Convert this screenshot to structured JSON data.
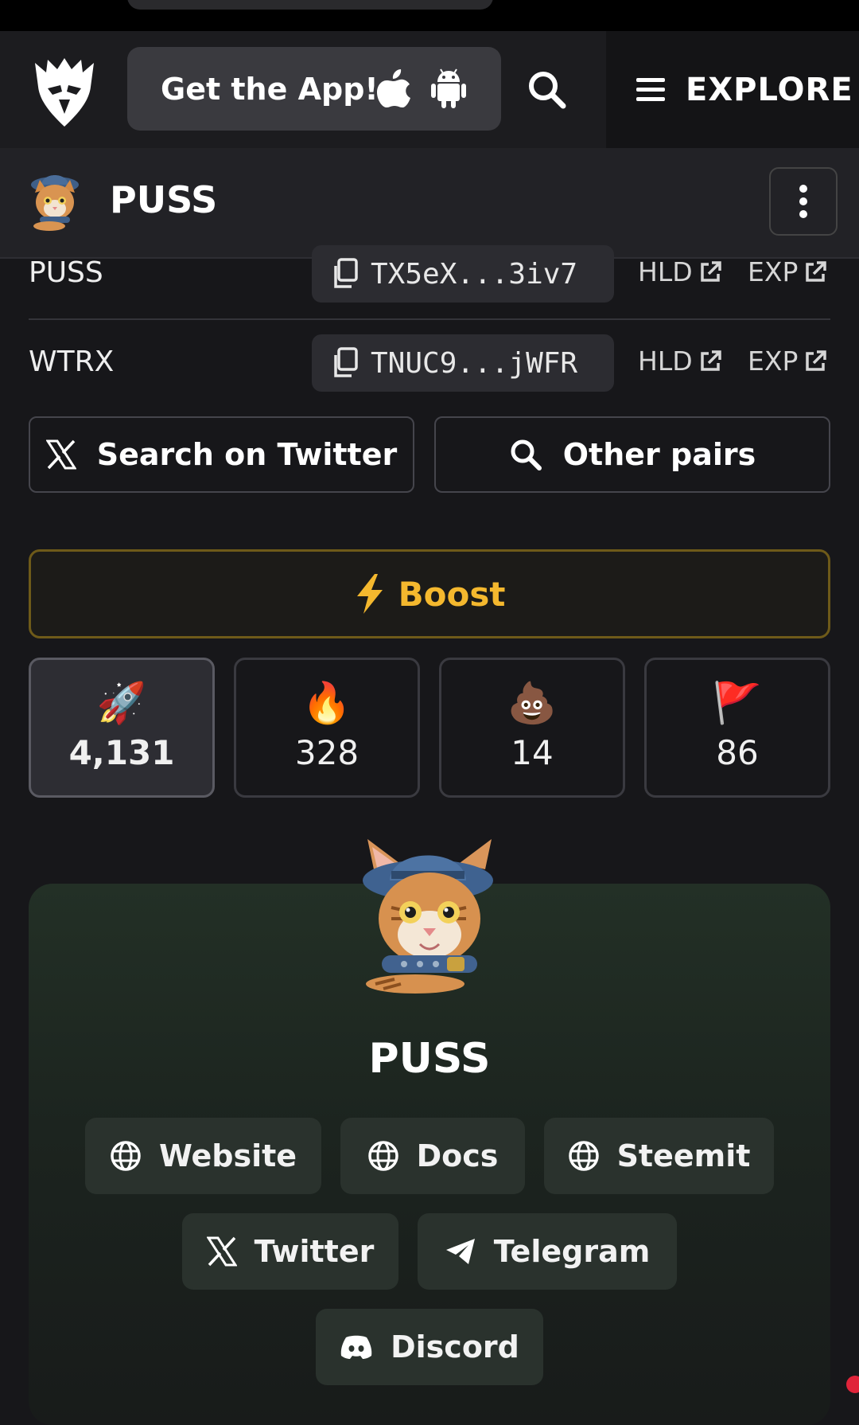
{
  "nav": {
    "get_app_label": "Get the App!",
    "explore_label": "EXPLORE"
  },
  "token_header": {
    "name": "PUSS"
  },
  "addresses": [
    {
      "symbol": "PUSS",
      "address": "TX5eX...3iv7",
      "holders_label": "HLD",
      "explorer_label": "EXP"
    },
    {
      "symbol": "WTRX",
      "address": "TNUC9...jWFR",
      "holders_label": "HLD",
      "explorer_label": "EXP"
    }
  ],
  "actions": {
    "twitter_search_label": "Search on Twitter",
    "other_pairs_label": "Other pairs",
    "boost_label": "Boost"
  },
  "reactions": [
    {
      "emoji": "🚀",
      "count": "4,131",
      "active": true
    },
    {
      "emoji": "🔥",
      "count": "328"
    },
    {
      "emoji": "💩",
      "count": "14"
    },
    {
      "emoji": "🚩",
      "count": "86"
    }
  ],
  "profile": {
    "name": "PUSS",
    "links": [
      "Website",
      "Docs",
      "Steemit",
      "Twitter",
      "Telegram",
      "Discord"
    ]
  },
  "colors": {
    "boost": "#f4b82e",
    "page_bg": "#17171a"
  },
  "icons": [
    "eagle-logo-icon",
    "apple-icon",
    "android-icon",
    "search-icon",
    "menu-icon",
    "kebab-icon",
    "copy-icon",
    "external-link-icon",
    "x-icon",
    "lightning-icon",
    "globe-icon",
    "telegram-icon",
    "discord-icon"
  ]
}
